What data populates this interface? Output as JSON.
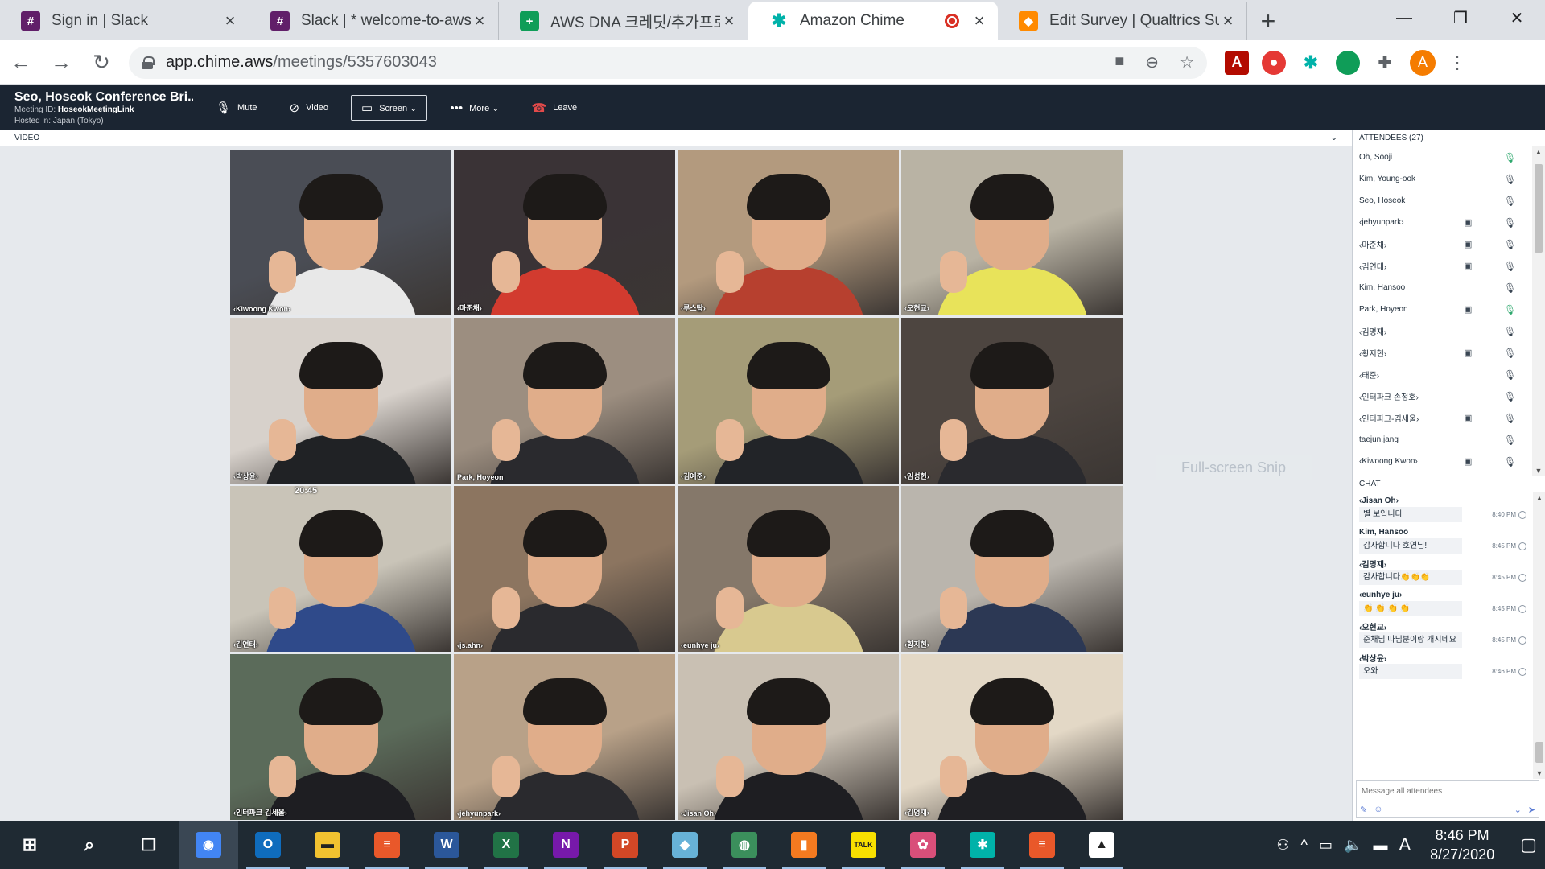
{
  "browser": {
    "tabs": [
      {
        "title": "Sign in | Slack",
        "icon": "slack-icon",
        "color": "#611f69",
        "glyph": "#",
        "active": false
      },
      {
        "title": "Slack | * welcome-to-aws-d",
        "icon": "slack-icon",
        "color": "#611f69",
        "glyph": "#",
        "active": false
      },
      {
        "title": "AWS DNA 크레딧/추가프로",
        "icon": "sheets-icon",
        "color": "#0f9d58",
        "glyph": "+",
        "active": false
      },
      {
        "title": "Amazon Chime",
        "icon": "chime-icon",
        "color": "#00b2a9",
        "glyph": "✱",
        "active": true
      },
      {
        "title": "Edit Survey | Qualtrics Surv",
        "icon": "qualtrics-icon",
        "color": "#ff8a00",
        "glyph": "◆",
        "active": false
      }
    ],
    "new_tab": "+",
    "url_host": "app.chime.aws",
    "url_path": "/meetings/5357603043"
  },
  "meeting": {
    "title": "Seo, Hoseok Conference Bri...",
    "meeting_id_label": "Meeting ID:",
    "meeting_id": "HoseokMeetingLink",
    "hosted_label": "Hosted in:",
    "hosted_in": "Japan (Tokyo)",
    "controls": {
      "mute": "Mute",
      "video": "Video",
      "screen": "Screen ⌄",
      "more": "More ⌄",
      "leave": "Leave"
    },
    "video_label": "VIDEO"
  },
  "tiles": [
    {
      "name": "‹Kiwoong Kwon›",
      "bg": "#4a4d55",
      "shirt": "#e8e8e8"
    },
    {
      "name": "‹마준채›",
      "bg": "#3a3336",
      "shirt": "#d23b2f"
    },
    {
      "name": "‹루스탐›",
      "bg": "#b39a7e",
      "shirt": "#b7402f"
    },
    {
      "name": "‹오현교›",
      "bg": "#b9b3a4",
      "shirt": "#e8e35a"
    },
    {
      "name": "‹박상윤›",
      "bg": "#d7d1cb",
      "shirt": "#202225"
    },
    {
      "name": "Park, Hoyeon",
      "bg": "#9c8e80",
      "shirt": "#2a2a2e"
    },
    {
      "name": "‹김예준›",
      "bg": "#a59c78",
      "shirt": "#222428"
    },
    {
      "name": "‹임성현›",
      "bg": "#4d4540",
      "shirt": "#2a2a2e"
    },
    {
      "name": "‹김연태›",
      "bg": "#c9c4b8",
      "shirt": "#2f4a8a"
    },
    {
      "name": "‹js.ahn›",
      "bg": "#8c7560",
      "shirt": "#2a2a2e"
    },
    {
      "name": "‹eunhye ju›",
      "bg": "#85786a",
      "shirt": "#d8c98f"
    },
    {
      "name": "‹황지현›",
      "bg": "#bab5ad",
      "shirt": "#2c3854"
    },
    {
      "name": "‹인터파크-김세울›",
      "bg": "#5b6b5a",
      "shirt": "#1e1e22"
    },
    {
      "name": "‹jehyunpark›",
      "bg": "#b8a188",
      "shirt": "#2a2a2e"
    },
    {
      "name": "‹Jisan Oh›",
      "bg": "#c9c0b3",
      "shirt": "#1e1e22"
    },
    {
      "name": "‹김명재›",
      "bg": "#e3d8c6",
      "shirt": "#1f1f23"
    }
  ],
  "tile_clock": "20:45",
  "attendees": {
    "header": "ATTENDEES (27)",
    "list": [
      {
        "name": "Oh, Sooji",
        "video": false,
        "mic_active": true
      },
      {
        "name": "Kim, Young-ook",
        "video": false,
        "mic_active": false
      },
      {
        "name": "Seo, Hoseok",
        "video": false,
        "mic_active": false
      },
      {
        "name": "‹jehyunpark›",
        "video": true,
        "mic_active": false
      },
      {
        "name": "‹마준채›",
        "video": true,
        "mic_active": false
      },
      {
        "name": "‹김연태›",
        "video": true,
        "mic_active": false
      },
      {
        "name": "Kim, Hansoo",
        "video": false,
        "mic_active": false
      },
      {
        "name": "Park, Hoyeon",
        "video": true,
        "mic_active": true
      },
      {
        "name": "‹김명재›",
        "video": false,
        "mic_active": false
      },
      {
        "name": "‹황지현›",
        "video": true,
        "mic_active": false
      },
      {
        "name": "‹태준›",
        "video": false,
        "mic_active": false
      },
      {
        "name": "‹인터파크 손정호›",
        "video": false,
        "mic_active": false
      },
      {
        "name": "‹인터파크-김세울›",
        "video": true,
        "mic_active": false
      },
      {
        "name": "taejun.jang",
        "video": false,
        "mic_active": false
      },
      {
        "name": "‹Kiwoong Kwon›",
        "video": true,
        "mic_active": false
      }
    ]
  },
  "chat": {
    "header": "CHAT",
    "messages": [
      {
        "sender": "‹Jisan Oh›",
        "text": "별 보입니다",
        "time": "8:40 PM"
      },
      {
        "sender": "Kim, Hansoo",
        "text": "감사합니다 호연님!!",
        "time": "8:45 PM"
      },
      {
        "sender": "‹김명재›",
        "text": "감사합니다👏👏👏",
        "time": "8:45 PM"
      },
      {
        "sender": "‹eunhye ju›",
        "text": "👏 👏 👏 👏",
        "time": "8:45 PM",
        "emoji": true
      },
      {
        "sender": "‹오현교›",
        "text": "준채님 따님분이랑 개시네요",
        "time": "8:45 PM"
      },
      {
        "sender": "‹박상윤›",
        "text": "오와",
        "time": "8:46 PM"
      }
    ],
    "input_placeholder": "Message all attendees"
  },
  "snip_overlay": "Full-screen Snip",
  "taskbar": {
    "apps": [
      {
        "icon": "chrome-icon",
        "color": "#4285f4",
        "glyph": "◉",
        "state": "active"
      },
      {
        "icon": "outlook-icon",
        "color": "#0f6cbd",
        "glyph": "O",
        "state": "running"
      },
      {
        "icon": "file-explorer-icon",
        "color": "#f2c230",
        "glyph": "▬",
        "state": "running"
      },
      {
        "icon": "presentation-app-icon",
        "color": "#e9582a",
        "glyph": "≡",
        "state": "running"
      },
      {
        "icon": "word-icon",
        "color": "#2b579a",
        "glyph": "W",
        "state": "running"
      },
      {
        "icon": "excel-icon",
        "color": "#217346",
        "glyph": "X",
        "state": "running"
      },
      {
        "icon": "onenote-icon",
        "color": "#7719aa",
        "glyph": "N",
        "state": "running"
      },
      {
        "icon": "powerpoint-icon",
        "color": "#d24726",
        "glyph": "P",
        "state": "running"
      },
      {
        "icon": "notebook-icon",
        "color": "#67b2d8",
        "glyph": "◆",
        "state": "running"
      },
      {
        "icon": "globe-app-icon",
        "color": "#3b8f5c",
        "glyph": "◍",
        "state": "running"
      },
      {
        "icon": "orange-app-icon",
        "color": "#f47a20",
        "glyph": "▮",
        "state": "running"
      },
      {
        "icon": "kakaotalk-icon",
        "color": "#f9e000",
        "glyph": "TALK",
        "state": "running"
      },
      {
        "icon": "network-app-icon",
        "color": "#d94f7a",
        "glyph": "✿",
        "state": "running"
      },
      {
        "icon": "chime-icon",
        "color": "#00b2a9",
        "glyph": "✱",
        "state": "running"
      },
      {
        "icon": "presentation-app-icon",
        "color": "#e9582a",
        "glyph": "≡",
        "state": "running"
      },
      {
        "icon": "photos-icon",
        "color": "#ffffff",
        "glyph": "▲",
        "state": "running"
      }
    ],
    "time": "8:46 PM",
    "date": "8/27/2020",
    "ime": "A"
  }
}
